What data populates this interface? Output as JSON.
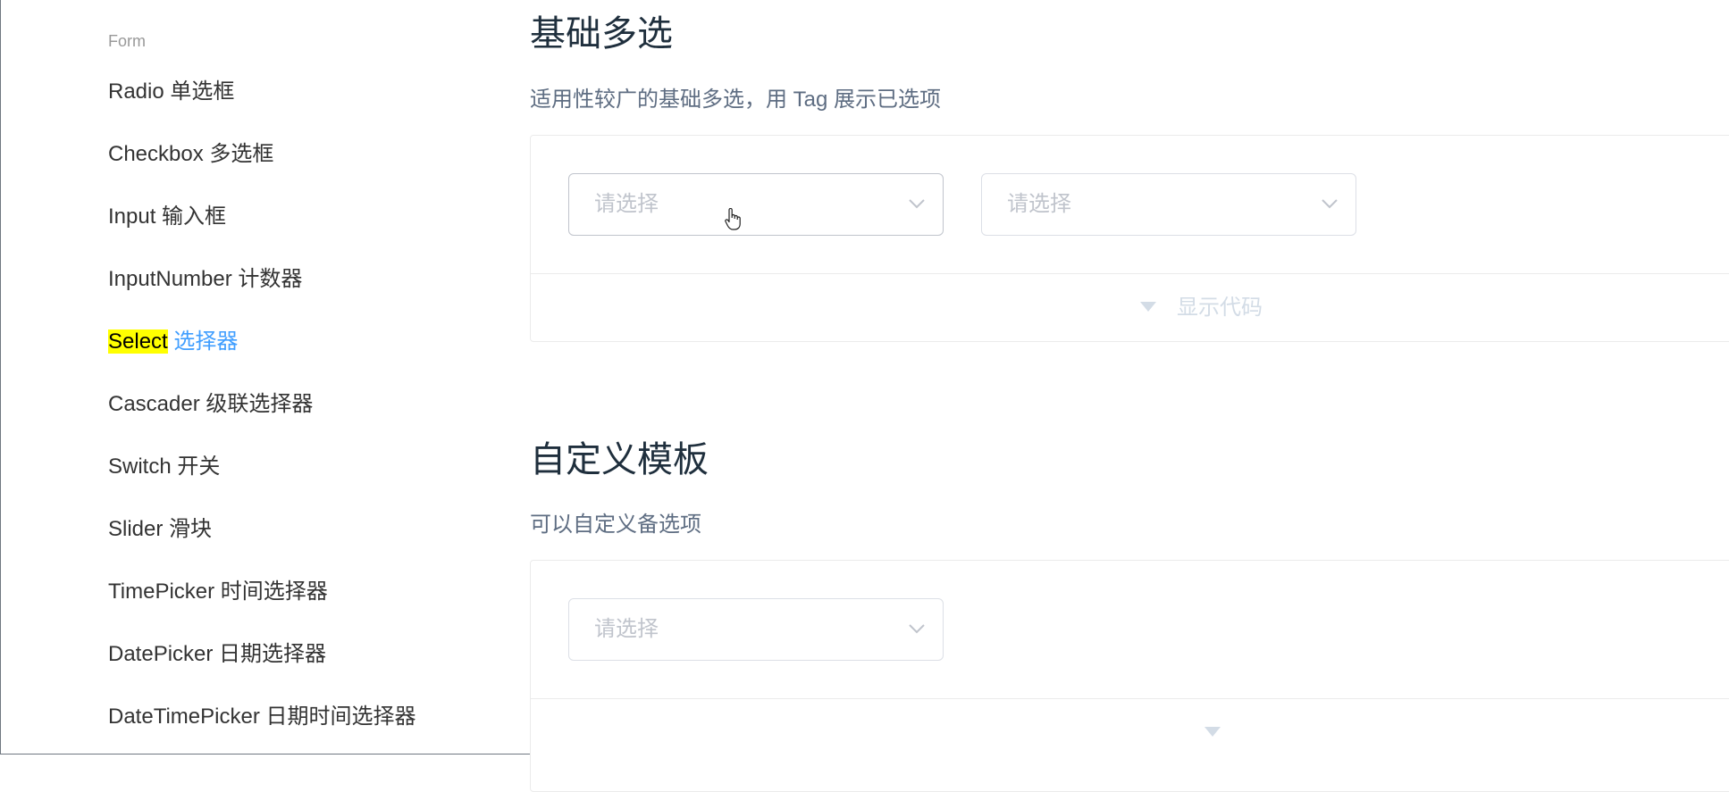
{
  "sidebar": {
    "group_title": "Form",
    "items": [
      {
        "label": "Radio 单选框"
      },
      {
        "label": "Checkbox 多选框"
      },
      {
        "label": "Input 输入框"
      },
      {
        "label": "InputNumber 计数器"
      },
      {
        "label_highlight": "Select",
        "label_rest": " 选择器"
      },
      {
        "label": "Cascader 级联选择器"
      },
      {
        "label": "Switch 开关"
      },
      {
        "label": "Slider 滑块"
      },
      {
        "label": "TimePicker 时间选择器"
      },
      {
        "label": "DatePicker 日期选择器"
      },
      {
        "label": "DateTimePicker 日期时间选择器"
      }
    ]
  },
  "sections": [
    {
      "title": "基础多选",
      "description": "适用性较广的基础多选，用 Tag 展示已选项",
      "selects": [
        {
          "placeholder": "请选择"
        },
        {
          "placeholder": "请选择"
        }
      ],
      "toggle_label": "显示代码"
    },
    {
      "title": "自定义模板",
      "description": "可以自定义备选项",
      "selects": [
        {
          "placeholder": "请选择"
        }
      ]
    }
  ],
  "colors": {
    "accent": "#409eff",
    "highlight": "#ffff00",
    "placeholder": "#c0c4cc",
    "border": "#dcdfe6"
  }
}
